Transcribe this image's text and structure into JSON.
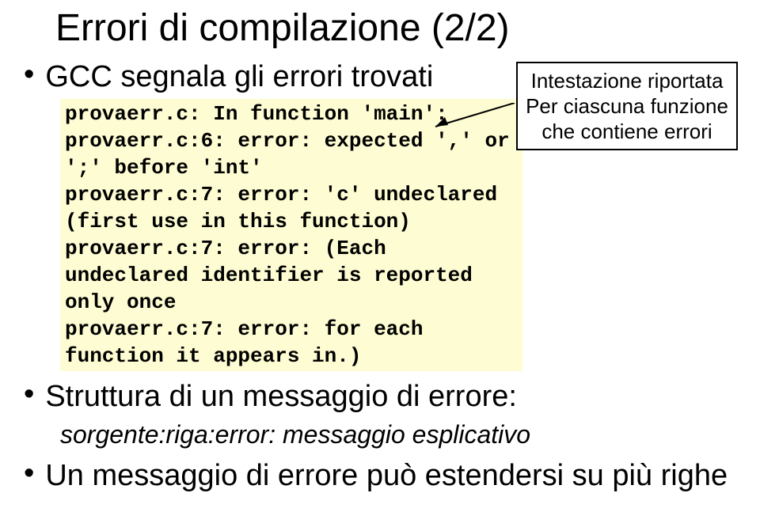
{
  "title": "Errori di compilazione (2/2)",
  "bullets": {
    "b1": "GCC segnala gli errori trovati",
    "b2": "Struttura di un messaggio di errore:",
    "b2_sub": "sorgente:riga:error: messaggio esplicativo",
    "b3": "Un messaggio di errore può estendersi su più righe"
  },
  "code": {
    "l1": "provaerr.c: In function 'main':",
    "l2": "provaerr.c:6: error: expected ',' or ';' before 'int'",
    "l3": "provaerr.c:7: error: 'c' undeclared (first use in this function)",
    "l4": "provaerr.c:7: error: (Each undeclared identifier is reported only once",
    "l5": "provaerr.c:7: error: for each function it appears in.)"
  },
  "callout": {
    "line1": "Intestazione riportata",
    "line2": "Per ciascuna funzione",
    "line3": "che contiene errori"
  }
}
